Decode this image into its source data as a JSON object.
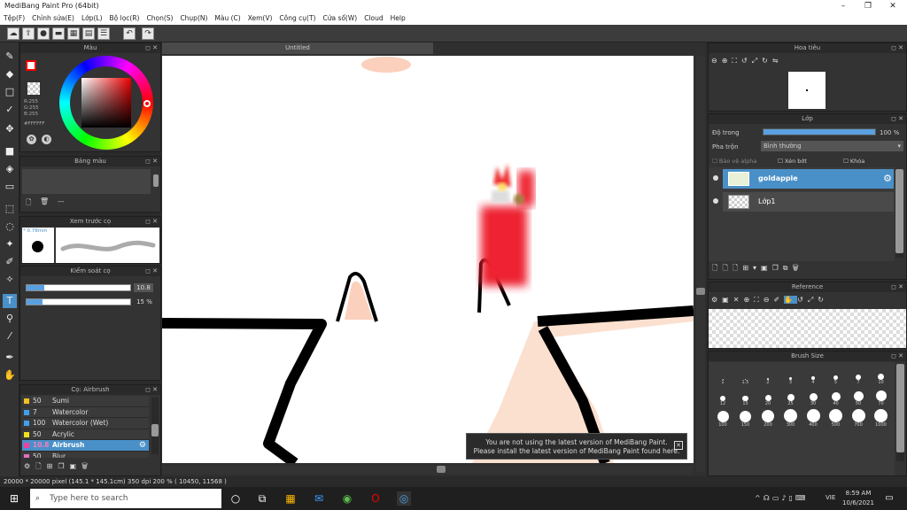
{
  "window": {
    "title": "MediBang Paint Pro (64bit)"
  },
  "menu": [
    "Tệp(F)",
    "Chỉnh sửa(E)",
    "Lớp(L)",
    "Bộ lọc(R)",
    "Chọn(S)",
    "Chụp(N)",
    "Màu (C)",
    "Xem(V)",
    "Công cụ(T)",
    "Cửa sổ(W)",
    "Cloud",
    "Help"
  ],
  "panels": {
    "color": "Màu",
    "palette": "Bảng màu",
    "brush_preview": "Xem trước cọ",
    "brush_control": "Kiểm soát cọ",
    "brush_list": "Cọ: Airbrush",
    "navigator": "Hoa tiêu",
    "layers": "Lớp",
    "reference": "Reference",
    "brush_size": "Brush Size"
  },
  "color_info": {
    "r": "R:255",
    "g": "G:255",
    "b": "B:255",
    "hex": "#FFFFFF"
  },
  "palette_label": "---",
  "preview_size": "* 0.78mm",
  "brush_control": {
    "size_value": "10.8",
    "size_fraction": 0.17,
    "opacity_value": "15 %",
    "opacity_fraction": 0.15
  },
  "brush_list": [
    {
      "size": "50",
      "name": "Sumi",
      "color": "#f0c020"
    },
    {
      "size": "7",
      "name": "Watercolor",
      "color": "#40a0f0"
    },
    {
      "size": "100",
      "name": "Watercolor (Wet)",
      "color": "#40a0f0"
    },
    {
      "size": "50",
      "name": "Acrylic",
      "color": "#f0e020"
    },
    {
      "size": "10.8",
      "name": "Airbrush",
      "color": "#f040a0",
      "active": true
    },
    {
      "size": "50",
      "name": "Blur",
      "color": "#e070c0"
    }
  ],
  "document": {
    "tab": "Untitled"
  },
  "layers_panel": {
    "opacity_label": "Độ trong",
    "opacity_value": "100 %",
    "opacity_fraction": 1.0,
    "blend_label": "Pha trộn",
    "blend_value": "Bình thường",
    "alpha_label": "Bảo vệ alpha",
    "clip_label": "Xén bớt",
    "lock_label": "Khóa",
    "items": [
      {
        "name": "goldapple",
        "active": true
      },
      {
        "name": "Lớp1",
        "active": false
      }
    ]
  },
  "brush_sizes": [
    [
      "1",
      "1.5",
      "2",
      "3",
      "4",
      "5",
      "7",
      "10"
    ],
    [
      "12",
      "15",
      "20",
      "25",
      "30",
      "40",
      "50",
      "70"
    ],
    [
      "100",
      "150",
      "200",
      "300",
      "400",
      "500",
      "700",
      "1000"
    ]
  ],
  "notice": {
    "line1": "You are not using the latest version of MediBang Paint.",
    "line2": "Please install the latest version of MediBang Paint found here."
  },
  "status": "20000 * 20000 pixel  (145.1 * 145.1cm)  350 dpi  200 %  ( 10450, 11568 )",
  "taskbar": {
    "search_placeholder": "Type here to search",
    "time": "8:59 AM",
    "date": "10/6/2021",
    "lang": "VIE"
  }
}
